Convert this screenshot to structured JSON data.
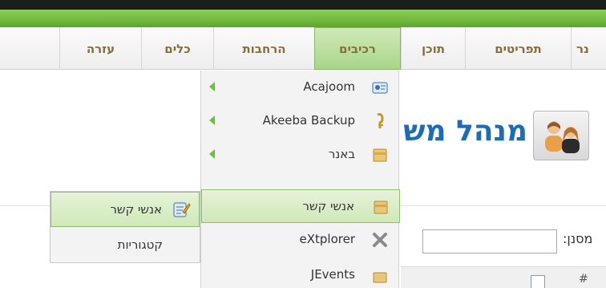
{
  "menubar": {
    "items": [
      {
        "label": "עזרה",
        "active": false
      },
      {
        "label": "כלים",
        "active": false
      },
      {
        "label": "הרחבות",
        "active": false
      },
      {
        "label": "רכיבים",
        "active": true
      },
      {
        "label": "תוכן",
        "active": false
      },
      {
        "label": "תפריטים",
        "active": false
      },
      {
        "label": "נר",
        "active": false
      }
    ]
  },
  "page": {
    "title": "מנהל מש",
    "filter_label": "מסנן:",
    "filter_value": "",
    "table_hash": "#"
  },
  "components_menu": {
    "items": [
      {
        "label": "Acajoom",
        "icon": "acajoom-icon",
        "has_submenu": true
      },
      {
        "label": "Akeeba Backup",
        "icon": "akeeba-icon",
        "has_submenu": true
      },
      {
        "label": "באנר",
        "icon": "banner-icon",
        "has_submenu": true
      },
      {
        "label": "אנשי קשר",
        "icon": "contacts-icon",
        "has_submenu": false,
        "highlighted": true
      },
      {
        "label": "eXtplorer",
        "icon": "extplorer-icon",
        "has_submenu": false
      },
      {
        "label": "JEvents",
        "icon": "jevents-icon",
        "has_submenu": false
      }
    ]
  },
  "contacts_submenu": {
    "items": [
      {
        "label": "אנשי קשר",
        "icon": "contacts-edit-icon",
        "highlighted": true
      },
      {
        "label": "קטגוריות",
        "icon": "",
        "highlighted": false
      }
    ]
  },
  "colors": {
    "accent_green": "#6cbf3b",
    "title_blue": "#1e6bb8",
    "menu_text": "#8a6d3b"
  }
}
